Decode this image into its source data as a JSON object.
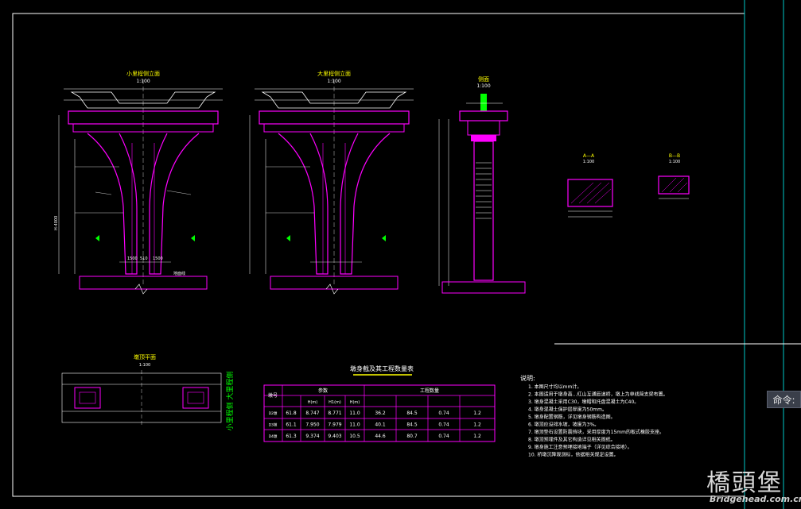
{
  "drawing": {
    "views": {
      "elev1_title": "小里程侧立面",
      "elev1_scale": "1:100",
      "elev2_title": "大里程侧立面",
      "elev2_scale": "1:100",
      "side_title": "侧面",
      "side_scale": "1:100",
      "sec_aa_title": "A—A",
      "sec_aa_scale": "1:100",
      "sec_bb_title": "B—B",
      "sec_bb_scale": "1:100",
      "plan_title": "墩顶平面",
      "plan_scale": "1:100",
      "plan_side_labels": "小里程侧  大里程侧"
    },
    "dims": {
      "w1500": "1500",
      "w510": "510",
      "w1500b": "1500",
      "h4000": "H-4000",
      "ground": "地面线"
    },
    "table": {
      "title": "墩身截及其工程数量表",
      "header_pier": "墩号",
      "header_params": "参数",
      "header_qty": "工程数量",
      "col_h1": "H(m)",
      "col_h2": "H1(m)",
      "col_h3": "H(m)",
      "rows": [
        {
          "id": "D2墩",
          "a": "61.8",
          "b": "8.747",
          "c": "8.771",
          "d": "11.0",
          "e": "36.2",
          "f": "84.5",
          "g": "0.74",
          "h": "1.2"
        },
        {
          "id": "D3墩",
          "a": "61.1",
          "b": "7.950",
          "c": "7.979",
          "d": "11.0",
          "e": "40.1",
          "f": "84.5",
          "g": "0.74",
          "h": "1.2"
        },
        {
          "id": "D4墩",
          "a": "61.3",
          "b": "9.374",
          "c": "9.403",
          "d": "10.5",
          "e": "44.6",
          "f": "80.7",
          "g": "0.74",
          "h": "1.2"
        }
      ]
    },
    "notes": {
      "title": "说明:",
      "lines": [
        "1. 本图尺寸均以mm计。",
        "2. 本图适用于墩身高…红山互通匝道桥，墩上为单线简支梁布置。",
        "3. 墩身混凝土采用C30，墩帽和托盘混凝土为C40。",
        "4. 墩身混凝土保护层厚度为50mm。",
        "5. 墩身配置钢筋，详见墩身钢筋构造图。",
        "6. 墩顶应设排水坡，坡度为3%。",
        "7. 墩顶垫石设置防震挡块，采用厚度为15mm的板式橡胶支座。",
        "8. 墩顶预埋件及其它构造详见相关图纸。",
        "9. 墩身施工注意预埋接地端子（详见综合接地）。",
        "10. 桥墩沉降观测标，依据相关规定设置。"
      ]
    }
  },
  "ui": {
    "command_label": "命令:",
    "icons": [
      "crosshair-cursor-icon"
    ]
  },
  "watermark": {
    "logo": "橋頭堡",
    "url": "Bridgehead.com.cn"
  },
  "colors": {
    "background": "#000000",
    "magenta": "#ff00ff",
    "white": "#ffffff",
    "green": "#00ff00",
    "yellow": "#ffff00",
    "cyan": "#00c8c8",
    "gray": "#909090"
  }
}
